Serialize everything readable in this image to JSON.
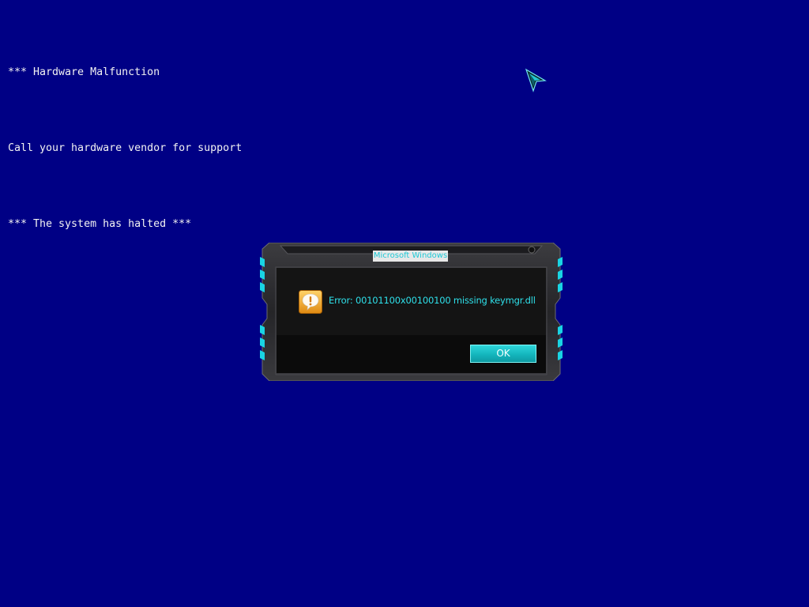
{
  "screen": {
    "background_color": "#000085",
    "lines": [
      "*** Hardware Malfunction",
      "Call your hardware vendor for support",
      "*** The system has halted ***"
    ]
  },
  "dialog": {
    "title": "Microsoft Windows",
    "message": "Error: 00101100x00100100 missing keymgr.dll",
    "icon": "warning-speech-bubble-icon",
    "ok_label": "OK",
    "accent_color": "#1ec9d6"
  },
  "cursor": {
    "icon": "arrow-cursor-icon"
  }
}
